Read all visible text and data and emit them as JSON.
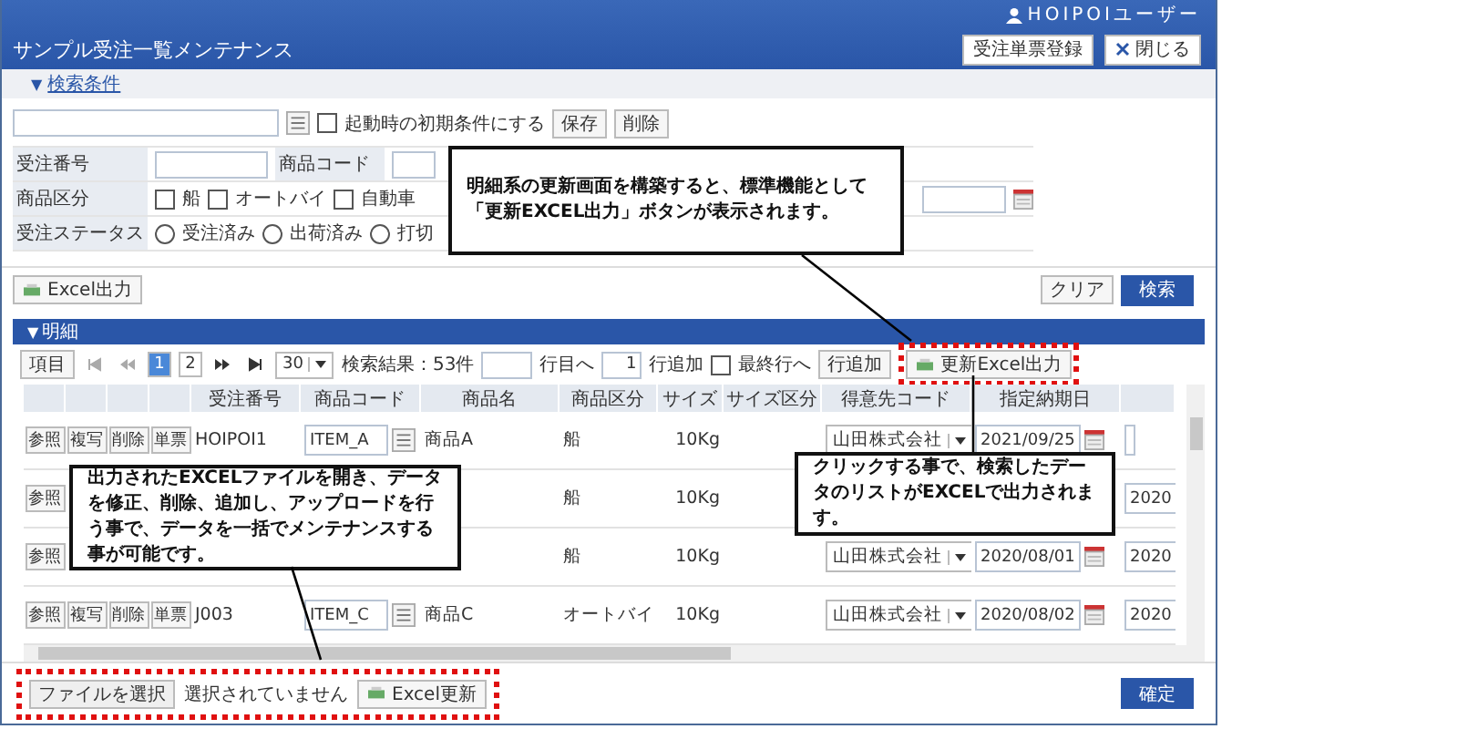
{
  "header": {
    "user": "HOIPOIユーザー",
    "title": "サンプル受注一覧メンテナンス",
    "register_button": "受注単票登録",
    "close_button": "閉じる"
  },
  "search": {
    "toggle_arrow": "▼",
    "toggle_label": "検索条件",
    "preset_checkbox": {
      "label": "起動時の初期条件にする",
      "checked": false
    },
    "save_button": "保存",
    "delete_button": "削除",
    "order_no_label": "受注番号",
    "item_code_label": "商品コード",
    "category_label": "商品区分",
    "categories": [
      {
        "label": "船",
        "checked": false
      },
      {
        "label": "オートバイ",
        "checked": false
      },
      {
        "label": "自動車",
        "checked": false
      }
    ],
    "status_label": "受注ステータス",
    "statuses": [
      {
        "label": "受注済み",
        "selected": false
      },
      {
        "label": "出荷済み",
        "selected": false
      },
      {
        "label": "打切",
        "selected": false
      }
    ],
    "excel_button": "Excel出力",
    "clear_button": "クリア",
    "search_button": "検索"
  },
  "detail": {
    "toggle_arrow": "▼",
    "toggle_label": "明細",
    "columns_button": "項目",
    "pages": [
      {
        "label": "1",
        "selected": true
      },
      {
        "label": "2",
        "selected": false
      }
    ],
    "page_size": "30",
    "result": "検索結果：53件",
    "goto_label": "行目へ",
    "add_count": "1",
    "add_count_label": "行追加",
    "last_row": {
      "label": "最終行へ",
      "checked": false
    },
    "add_button": "行追加",
    "update_export_button": "更新Excel出力",
    "columns": [
      "受注番号",
      "商品コード",
      "商品名",
      "商品区分",
      "サイズ",
      "サイズ区分",
      "得意先コード",
      "指定納期日"
    ],
    "rows": [
      {
        "buttons": [
          "参照",
          "複写",
          "削除",
          "単票"
        ],
        "order_no": "HOIPOI1",
        "item_code": "ITEM_A",
        "item_name": "商品A",
        "category": "船",
        "size": "10Kg",
        "customer": "山田株式会社",
        "due_date": "2021/09/25"
      },
      {
        "buttons": [
          "参照"
        ],
        "category": "船",
        "size": "10Kg",
        "column_10": "2020"
      },
      {
        "buttons": [
          "参照"
        ],
        "category": "船",
        "size": "10Kg",
        "customer": "山田株式会社",
        "due_date": "2020/08/01",
        "column_10": "2020"
      },
      {
        "buttons": [
          "参照",
          "複写",
          "削除",
          "単票"
        ],
        "order_no": "J003",
        "item_code": "ITEM_C",
        "item_name": "商品C",
        "category": "オートバイ",
        "size": "10Kg",
        "customer": "山田株式会社",
        "due_date": "2020/08/02",
        "column_10": "2020"
      }
    ]
  },
  "footer": {
    "file_button": "ファイルを選択",
    "file_status": "選択されていません",
    "update_button": "Excel更新",
    "confirm_button": "確定"
  },
  "callouts": [
    {
      "text": "明細系の更新画面を構築すると、標準機能として「更新EXCEL出力」ボタンが表示されます。"
    },
    {
      "text": "出力されたEXCELファイルを開き、データを修正、削除、追加し、アップロードを行う事で、データを一括でメンテナンスする事が可能です。"
    },
    {
      "text": "クリックする事で、検索したデータのリストがEXCELで出力されます。"
    }
  ]
}
